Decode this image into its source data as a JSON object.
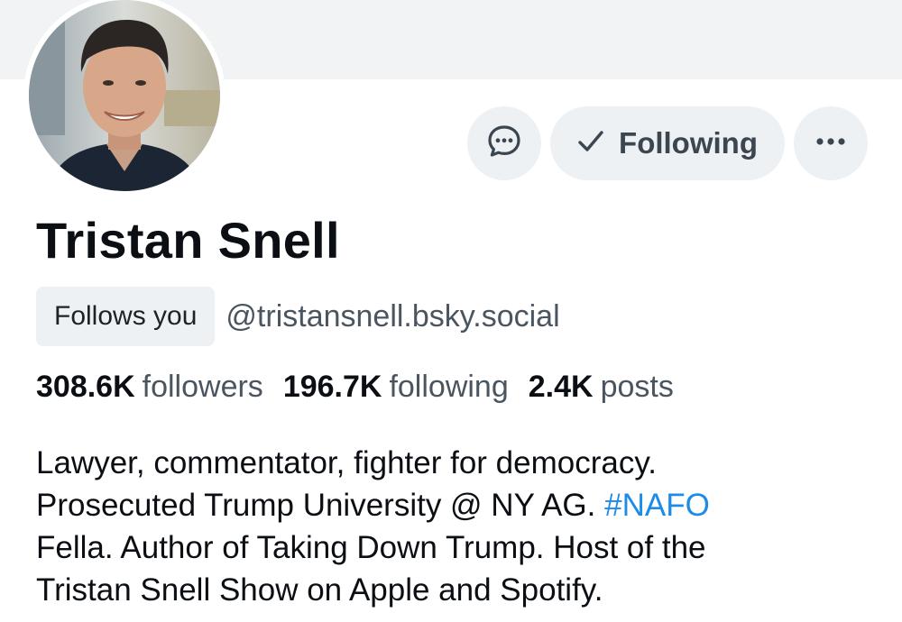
{
  "profile": {
    "display_name": "Tristan Snell",
    "follows_you_label": "Follows you",
    "handle": "@tristansnell.bsky.social"
  },
  "actions": {
    "message_icon": "chat-bubble-icon",
    "following_label": "Following",
    "following_icon": "checkmark-icon",
    "more_icon": "ellipsis-icon"
  },
  "stats": {
    "followers_count": "308.6K",
    "followers_label": "followers",
    "following_count": "196.7K",
    "following_label": "following",
    "posts_count": "2.4K",
    "posts_label": "posts"
  },
  "bio": {
    "line1": "Lawyer, commentator, fighter for democracy.",
    "line2_text": "Prosecuted Trump University @ NY AG. ",
    "line2_hashtag": "#NAFO",
    "line3": "Fella. Author of Taking Down Trump. Host of the",
    "line4": "Tristan Snell Show on Apple and Spotify."
  },
  "colors": {
    "banner": "#f1f3f5",
    "button_bg": "#eef1f4",
    "hashtag": "#1d8be8",
    "muted_text": "#4a5560"
  }
}
